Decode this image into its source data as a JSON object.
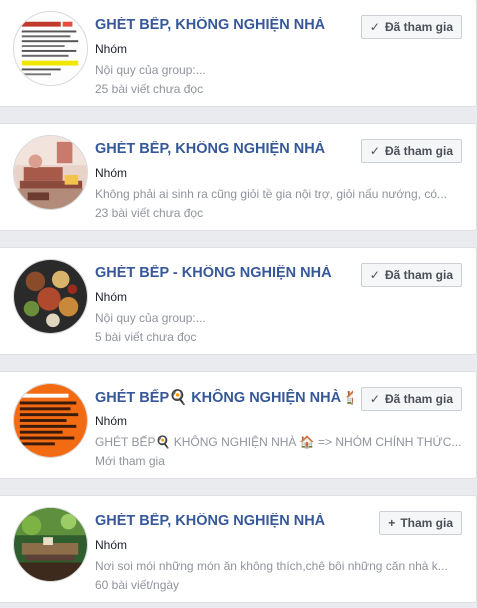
{
  "groups": [
    {
      "title": "GHÉT BẾP, KHÔNG NGHIỆN NHÀ",
      "title_emoji": "",
      "kind": "Nhóm",
      "description": "Nội quy của group:...",
      "stat": "25 bài viết chưa đọc",
      "button_label": "Đã tham gia",
      "button_icon": "check-icon",
      "avatar_icon": "document-thumbnail-icon"
    },
    {
      "title": "GHÉT BẾP, KHÔNG NGHIỆN NHÀ",
      "title_emoji": "",
      "kind": "Nhóm",
      "description": "Không phải ai sinh ra cũng giỏi tề gia nội trợ, giỏi nấu nướng, có...",
      "stat": "23 bài viết chưa đọc",
      "button_label": "Đã tham gia",
      "button_icon": "check-icon",
      "avatar_icon": "room-photo-icon"
    },
    {
      "title": "GHÉT BẾP - KHÔNG NGHIỆN NHÀ",
      "title_emoji": "",
      "kind": "Nhóm",
      "description": "Nội quy của group:...",
      "stat": "5 bài viết chưa đọc",
      "button_label": "Đã tham gia",
      "button_icon": "check-icon",
      "avatar_icon": "food-table-photo-icon"
    },
    {
      "title": "GHÉT BẾP🍳 KHÔNG NGHIỆN NHÀ",
      "title_emoji": "🏠",
      "kind": "Nhóm",
      "description": "GHÉT BẾP🍳 KHÔNG NGHIỆN NHÀ 🏠 => NHÓM CHÍNH THỨC...",
      "stat": "Mới tham gia",
      "button_label": "Đã tham gia",
      "button_icon": "check-icon",
      "avatar_icon": "rules-poster-icon"
    },
    {
      "title": "GHÉT BẾP, KHÔNG NGHIỆN NHÀ",
      "title_emoji": "",
      "kind": "Nhóm",
      "description": "Nơi soi mói những món ăn không thích,chê bôi những căn nhà k...",
      "stat": "60 bài viết/ngày",
      "button_label": "Tham gia",
      "button_icon": "plus-icon",
      "avatar_icon": "green-interior-photo-icon"
    }
  ]
}
